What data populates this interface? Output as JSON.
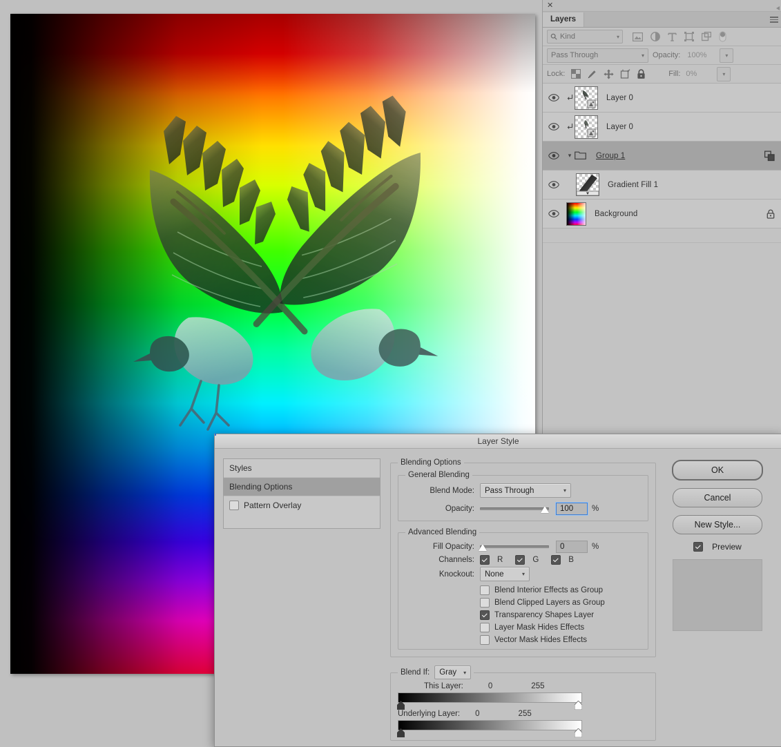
{
  "layers_panel": {
    "close_icon": "close-icon",
    "tab_label": "Layers",
    "menu_icon": "panel-menu-icon",
    "filter": {
      "search_icon": "search-icon",
      "kind_label": "Kind",
      "chevron": "chevron-down-icon",
      "icons": [
        "pixel-filter-icon",
        "adjustment-filter-icon",
        "type-filter-icon",
        "shape-filter-icon",
        "smartobject-filter-icon",
        "filter-toggle-icon"
      ]
    },
    "blend_mode": "Pass Through",
    "opacity_label": "Opacity:",
    "opacity_value": "100%",
    "lock_label": "Lock:",
    "lock_icons": [
      "lock-transparent-pixels-icon",
      "lock-image-pixels-icon",
      "lock-position-icon",
      "lock-artboard-nesting-icon",
      "lock-all-icon"
    ],
    "fill_label": "Fill:",
    "fill_value": "0%",
    "rows": [
      {
        "name": "Layer 0",
        "visible": true,
        "clipped": true,
        "selected": false,
        "kind": "pixel"
      },
      {
        "name": "Layer 0",
        "visible": true,
        "clipped": true,
        "selected": false,
        "kind": "pixel"
      },
      {
        "name": "Group 1",
        "visible": true,
        "clipped": false,
        "selected": true,
        "kind": "group",
        "expanded": true,
        "right_icon": "link-layers-icon"
      },
      {
        "name": "Gradient Fill 1",
        "visible": true,
        "clipped": false,
        "selected": false,
        "kind": "gradient-fill"
      },
      {
        "name": "Background",
        "visible": true,
        "clipped": false,
        "selected": false,
        "kind": "background",
        "right_icon": "lock-icon"
      }
    ]
  },
  "layer_style": {
    "title": "Layer Style",
    "styles_list": [
      {
        "label": "Styles",
        "type": "nav",
        "active": false
      },
      {
        "label": "Blending Options",
        "type": "nav",
        "active": true
      },
      {
        "label": "Pattern Overlay",
        "type": "checkbox",
        "checked": false,
        "active": false
      }
    ],
    "blending_options_legend": "Blending Options",
    "general_blending": {
      "legend": "General Blending",
      "blend_mode_label": "Blend Mode:",
      "blend_mode_value": "Pass Through",
      "opacity_label": "Opacity:",
      "opacity_value": "100",
      "opacity_unit": "%"
    },
    "advanced_blending": {
      "legend": "Advanced Blending",
      "fill_opacity_label": "Fill Opacity:",
      "fill_opacity_value": "0",
      "fill_opacity_unit": "%",
      "channels_label": "Channels:",
      "channels": [
        {
          "label": "R",
          "checked": true
        },
        {
          "label": "G",
          "checked": true
        },
        {
          "label": "B",
          "checked": true
        }
      ],
      "knockout_label": "Knockout:",
      "knockout_value": "None",
      "checkboxes": [
        {
          "label": "Blend Interior Effects as Group",
          "checked": false
        },
        {
          "label": "Blend Clipped Layers as Group",
          "checked": false
        },
        {
          "label": "Transparency Shapes Layer",
          "checked": true
        },
        {
          "label": "Layer Mask Hides Effects",
          "checked": false
        },
        {
          "label": "Vector Mask Hides Effects",
          "checked": false
        }
      ]
    },
    "blend_if": {
      "legend": "Blend If:",
      "channel_value": "Gray",
      "this_layer_label": "This Layer:",
      "this_layer_min": "0",
      "this_layer_max": "255",
      "underlying_layer_label": "Underlying Layer:",
      "underlying_layer_min": "0",
      "underlying_layer_max": "255"
    },
    "buttons": {
      "ok": "OK",
      "cancel": "Cancel",
      "new_style": "New Style...",
      "preview_label": "Preview",
      "preview_checked": true
    }
  },
  "document": {
    "description": "color-spectrum-gradient-with-mirrored-bird-wings"
  }
}
